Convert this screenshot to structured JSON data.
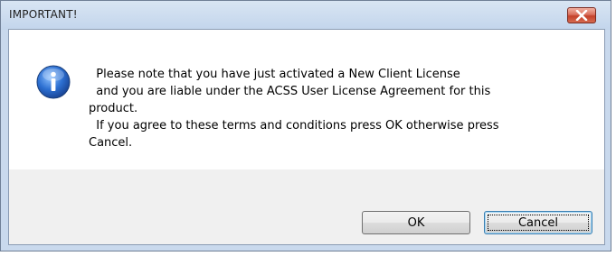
{
  "dialog": {
    "title": "IMPORTANT!",
    "icon": "info-icon",
    "message": "  Please note that you have just activated a New Client License\n  and you are liable under the ACSS User License Agreement for this\nproduct.\n  If you agree to these terms and conditions press OK otherwise press\nCancel.",
    "ok_label": "OK",
    "cancel_label": "Cancel",
    "close_icon": "close-icon",
    "colors": {
      "frame": "#c9d9ed",
      "close_button": "#c4412a",
      "info_icon": "#2c6fd1"
    }
  }
}
